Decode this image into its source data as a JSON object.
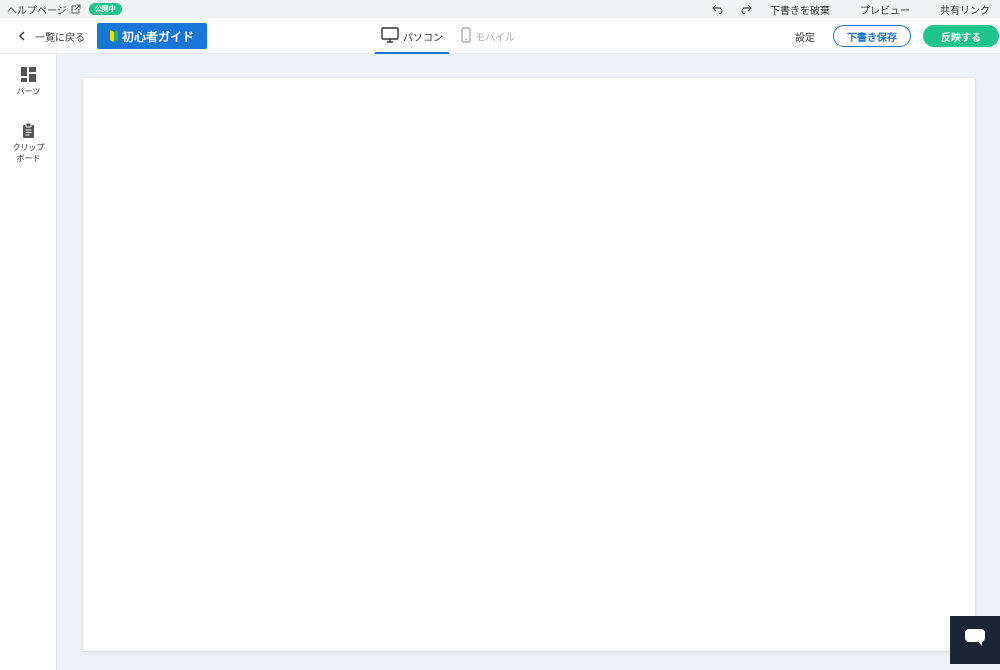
{
  "topbar": {
    "help_page": "ヘルプページ",
    "status": "公開中",
    "discard_draft": "下書きを破棄",
    "preview": "プレビュー",
    "share_link": "共有リンク"
  },
  "toolbar": {
    "back": "一覧に戻る",
    "guide": "初心者ガイド",
    "tabs": [
      {
        "label": "パソコン",
        "icon": "monitor-icon"
      },
      {
        "label": "モバイル",
        "icon": "mobile-icon"
      }
    ],
    "settings": "設定",
    "save_draft": "下書き保存",
    "publish": "反映する"
  },
  "sidebar": {
    "items": [
      {
        "label": "パーツ",
        "icon": "parts-grid-icon"
      },
      {
        "label": "クリップボード",
        "line1": "クリップ",
        "line2": "ボード",
        "icon": "clipboard-icon"
      }
    ]
  },
  "colors": {
    "accent": "#1877d6",
    "success": "#1fc48a",
    "chat": "#1d2636"
  }
}
